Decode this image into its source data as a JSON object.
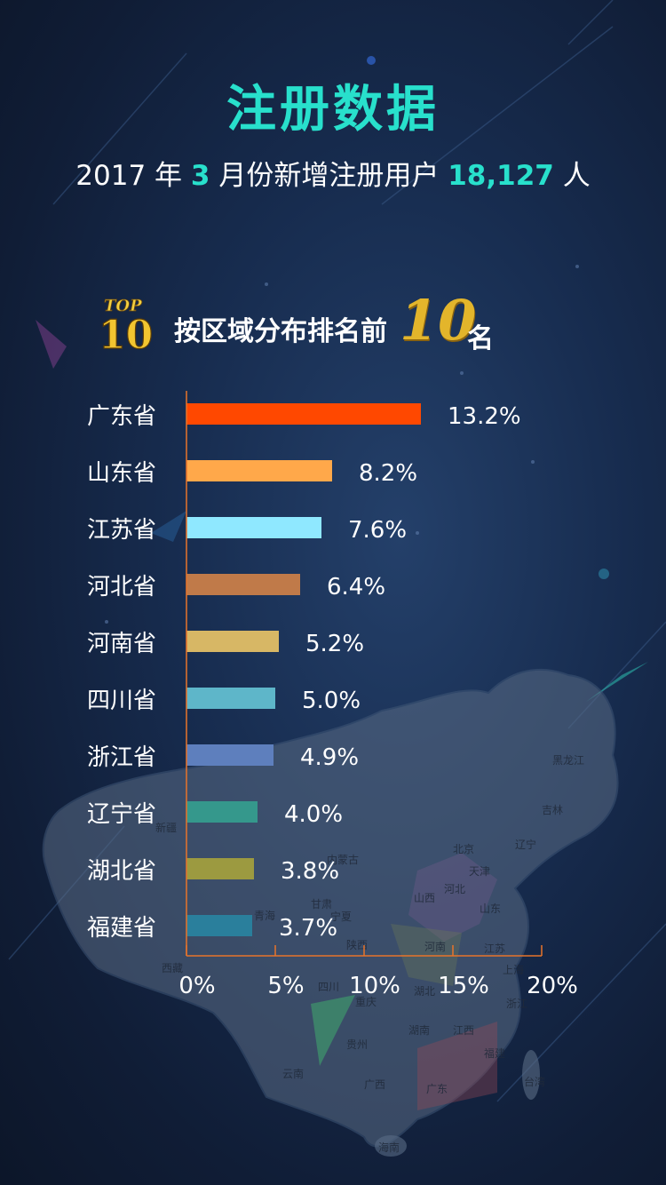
{
  "header": {
    "title": "注册数据",
    "subtitle_prefix": "2017 年 ",
    "month": "3",
    "subtitle_mid": " 月份新增注册用户 ",
    "count": "18,127",
    "subtitle_suffix": " 人"
  },
  "section": {
    "badge_top": "TOP",
    "badge_num": "10",
    "title_left": "按区域分布排名前",
    "title_num": "10",
    "title_right": "名"
  },
  "map_labels": [
    "黑龙江",
    "吉林",
    "辽宁",
    "北京",
    "天津",
    "内蒙古",
    "新疆",
    "河北",
    "山西",
    "山东",
    "甘肃",
    "宁夏",
    "青海",
    "陕西",
    "河南",
    "江苏",
    "西藏",
    "四川",
    "重庆",
    "湖北",
    "上海",
    "浙江",
    "湖南",
    "江西",
    "贵州",
    "云南",
    "福建",
    "广西",
    "广东",
    "台湾",
    "海南"
  ],
  "chart_data": {
    "type": "bar",
    "orientation": "horizontal",
    "categories": [
      "广东省",
      "山东省",
      "江苏省",
      "河北省",
      "河南省",
      "四川省",
      "浙江省",
      "辽宁省",
      "湖北省",
      "福建省"
    ],
    "values": [
      13.2,
      8.2,
      7.6,
      6.4,
      5.2,
      5.0,
      4.9,
      4.0,
      3.8,
      3.7
    ],
    "value_labels": [
      "13.2%",
      "8.2%",
      "7.6%",
      "6.4%",
      "5.2%",
      "5.0%",
      "4.9%",
      "4.0%",
      "3.8%",
      "3.7%"
    ],
    "colors": [
      "#ff4800",
      "#ffa84a",
      "#8fe8ff",
      "#c07a49",
      "#d7b765",
      "#5eb6c9",
      "#5e7fbd",
      "#35988c",
      "#9c9a40",
      "#2a7f9c"
    ],
    "xlim": [
      0,
      20
    ],
    "xticks": [
      "0%",
      "5%",
      "10%",
      "15%",
      "20%"
    ],
    "axis_color": "#e8742a"
  }
}
